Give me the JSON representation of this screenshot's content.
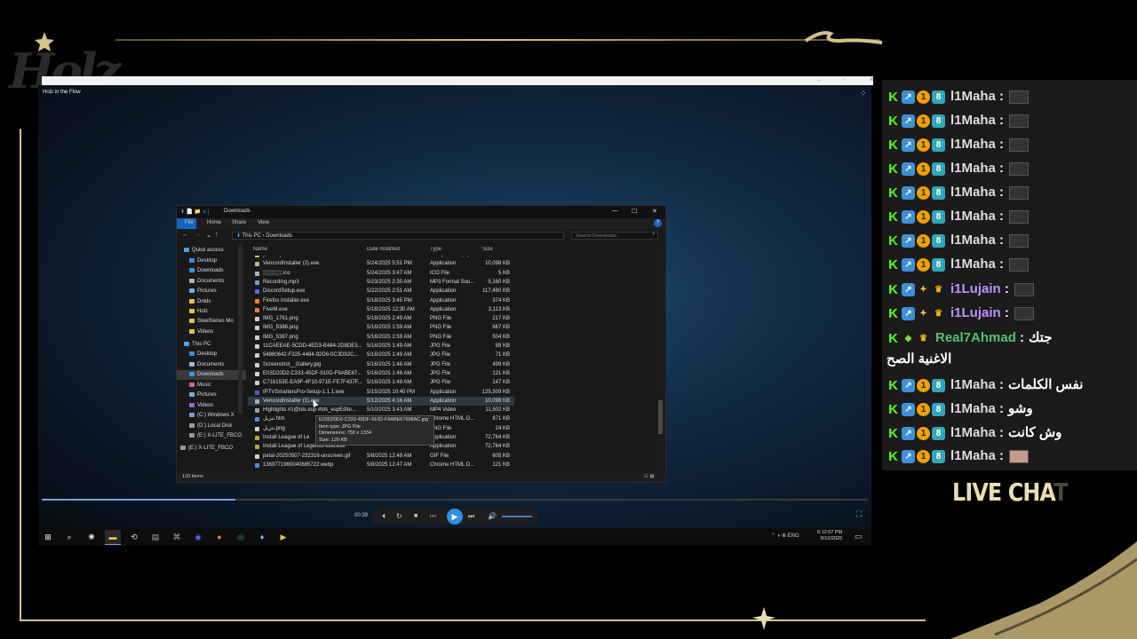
{
  "overlay": {
    "logo_text": "Holz",
    "live_chat_a": "LIVE CHA",
    "live_chat_b": "T"
  },
  "video": {
    "window_title": "Holz in the Flow",
    "window_controls": "– ▫ ✕",
    "grid_glyph": "⁘"
  },
  "explorer": {
    "title": "Downloads",
    "title_icons": "⬇ 📄 📁 ∨ |",
    "controls": {
      "min": "—",
      "max": "☐",
      "close": "✕"
    },
    "ribbon_tabs": [
      "File",
      "Home",
      "Share",
      "View"
    ],
    "address": {
      "pc": "This PC",
      "sep": "›",
      "folder": "Downloads"
    },
    "nav_arrows": [
      "←",
      "→",
      "⌄",
      "↑"
    ],
    "search_placeholder": "Search Downloads",
    "columns": {
      "name": "Name",
      "date": "Date modified",
      "type": "Type",
      "size": "Size"
    },
    "nav": [
      {
        "label": "Quick access",
        "color": "#4aa3f0"
      },
      {
        "label": "Desktop",
        "color": "#3a8ee0"
      },
      {
        "label": "Downloads",
        "color": "#2a9ae8"
      },
      {
        "label": "Documents",
        "color": "#9fb8d0"
      },
      {
        "label": "Pictures",
        "color": "#6ab0e8"
      },
      {
        "label": "Dnlds",
        "color": "#e8c04a"
      },
      {
        "label": "Holz",
        "color": "#e8c04a"
      },
      {
        "label": "SteelSeries Mo",
        "color": "#e8c04a"
      },
      {
        "label": "Videos",
        "color": "#e8c04a"
      },
      {
        "label": "This PC",
        "color": "#4aa3f0"
      },
      {
        "label": "Desktop",
        "color": "#3a8ee0"
      },
      {
        "label": "Documents",
        "color": "#9fb8d0"
      },
      {
        "label": "Downloads",
        "color": "#2a9ae8"
      },
      {
        "label": "Music",
        "color": "#e06080"
      },
      {
        "label": "Pictures",
        "color": "#6ab0e8"
      },
      {
        "label": "Videos",
        "color": "#a060e0"
      },
      {
        "label": "(C:) Windows X",
        "color": "#7aa0c0"
      },
      {
        "label": "(D:) Local Disk",
        "color": "#9a9a9a"
      },
      {
        "label": "(E:) X-LITE_FBCO",
        "color": "#9a9a9a"
      },
      {
        "label": "(E:) X-LITE_FBCO",
        "color": "#9a9a9a"
      }
    ],
    "files": [
      {
        "name": "yeez.zip",
        "date": "5/21/2025 2:19 AM",
        "type": "Compressed (zip...",
        "size": "2,882 KB",
        "color": "#e8c04a"
      },
      {
        "name": "VencordInstaller (2).exe",
        "date": "5/24/2025 5:51 PM",
        "type": "Application",
        "size": "10,098 KB",
        "color": "#b0b0b0"
      },
      {
        "name": "░░░░░.ico",
        "date": "5/24/2025 3:47 AM",
        "type": "ICO File",
        "size": "5 KB",
        "color": "#b0b0b0"
      },
      {
        "name": "Recording.mp3",
        "date": "5/23/2025 2:30 AM",
        "type": "MP3 Format Sou...",
        "size": "5,160 KB",
        "color": "#6aa0e0"
      },
      {
        "name": "DiscordSetup.exe",
        "date": "5/22/2025 2:51 AM",
        "type": "Application",
        "size": "117,480 KB",
        "color": "#5865f2"
      },
      {
        "name": "Firefox Installer.exe",
        "date": "5/18/2025 3:45 PM",
        "type": "Application",
        "size": "374 KB",
        "color": "#ff7b2a"
      },
      {
        "name": "FiveM.exe",
        "date": "5/18/2025 12:30 AM",
        "type": "Application",
        "size": "3,113 KB",
        "color": "#f08030"
      },
      {
        "name": "IMG_1761.png",
        "date": "5/18/2025 2:49 AM",
        "type": "PNG File",
        "size": "217 KB",
        "color": "#d0d0d0"
      },
      {
        "name": "IMG_5386.png",
        "date": "5/16/2025 1:59 AM",
        "type": "PNG File",
        "size": "667 KB",
        "color": "#d0d0d0"
      },
      {
        "name": "IMG_5387.png",
        "date": "5/16/2025 1:59 AM",
        "type": "PNG File",
        "size": "504 KB",
        "color": "#d0d0d0"
      },
      {
        "name": "11CAEEAE-5CDD-4ED3-B484-2D8DE3...",
        "date": "5/16/2025 1:49 AM",
        "type": "JPG File",
        "size": "89 KB",
        "color": "#d0d0d0"
      },
      {
        "name": "54860642-F325-4484-92D6-0C3D92C...",
        "date": "5/16/2025 1:49 AM",
        "type": "JPG File",
        "size": "71 KB",
        "color": "#d0d0d0"
      },
      {
        "name": "Screenshot__Gallery.jpg",
        "date": "5/16/2025 1:48 AM",
        "type": "JPG File",
        "size": "499 KB",
        "color": "#d0d0d0"
      },
      {
        "name": "E03D20D2-C333-45DF-910D-F9ABE67...",
        "date": "5/16/2025 1:48 AM",
        "type": "JPG File",
        "size": "121 KB",
        "color": "#d0d0d0"
      },
      {
        "name": "C716153E-EA9F-4F10-971E-FE7F437F...",
        "date": "5/16/2025 1:48 AM",
        "type": "JPG File",
        "size": "147 KB",
        "color": "#d0d0d0"
      },
      {
        "name": "IPTVSmartersPro-Setup-1.1.1.exe",
        "date": "5/15/2025 10:40 PM",
        "type": "Application",
        "size": "125,509 KB",
        "color": "#6050e0"
      },
      {
        "name": "VencordInstaller (1).exe",
        "date": "5/12/2025 4:16 AM",
        "type": "Application",
        "size": "10,098 KB",
        "color": "#b0b0b0"
      },
      {
        "name": "Highlights #1@tds.esp #tds_espEdite...",
        "date": "5/10/2025 3:43 AM",
        "type": "MP4 Video",
        "size": "11,502 KB",
        "color": "#a0a0a0"
      },
      {
        "name": "تنزيل.htm",
        "date": "",
        "type": "Chrome HTML D...",
        "size": "871 KB",
        "color": "#4a90e0"
      },
      {
        "name": "تنزيل.png",
        "date": "",
        "type": "PNG File",
        "size": "24 KB",
        "color": "#d0d0d0"
      },
      {
        "name": "Install League of Le",
        "date": "",
        "type": "Application",
        "size": "72,764 KB",
        "color": "#c0a040"
      },
      {
        "name": "Install League of Legends euw.exe",
        "date": "",
        "type": "Application",
        "size": "72,764 KB",
        "color": "#c0a040"
      },
      {
        "name": "petal-20250507-232316-unscreen.gif",
        "date": "5/8/2025 12:49 AM",
        "type": "GIF File",
        "size": "605 KB",
        "color": "#d0d0d0"
      },
      {
        "name": "1369771960040685722.webp",
        "date": "5/8/2025 12:47 AM",
        "type": "Chrome HTML D...",
        "size": "121 KB",
        "color": "#4a90e0"
      }
    ],
    "tooltip": {
      "l1": "E03D20D2-C333-45DF-910D-F9ABE67698AC.jpg",
      "l2": "Item type: JPG File",
      "l3": "Dimensions: 750 x 1334",
      "l4": "Size: 120 KB"
    },
    "status": "120 items",
    "view_icons": "☷ ▦"
  },
  "player": {
    "elapsed": "00:39",
    "progress_fraction": 0.234,
    "buttons": {
      "slow": "⏴",
      "loop": "↻",
      "stop": "■",
      "prev": "⏮",
      "play": "▶",
      "next": "⏭",
      "volume": "🔊"
    },
    "fullscreen_glyph": "⛶"
  },
  "taskbar": {
    "icons": [
      {
        "glyph": "⊞",
        "name": "windows-start-icon",
        "color": "#ffffff"
      },
      {
        "glyph": "⌕",
        "name": "search-icon",
        "color": "#ffffff"
      },
      {
        "glyph": "✺",
        "name": "settings-icon",
        "color": "#dddddd"
      },
      {
        "glyph": "▬",
        "name": "file-explorer-icon",
        "color": "#e8c04a"
      },
      {
        "glyph": "⟲",
        "name": "back-app-icon",
        "color": "#dddddd"
      },
      {
        "glyph": "▤",
        "name": "app-icon",
        "color": "#aaaaaa"
      },
      {
        "glyph": "⌘",
        "name": "terminal-icon",
        "color": "#aaaaaa"
      },
      {
        "glyph": "◉",
        "name": "obs-icon",
        "color": "#5865f2"
      },
      {
        "glyph": "●",
        "name": "firefox-icon",
        "color": "#ff7b2a"
      },
      {
        "glyph": "◎",
        "name": "chrome-icon",
        "color": "#34a853"
      },
      {
        "glyph": "♦",
        "name": "steam-icon",
        "color": "#66c0f4"
      },
      {
        "glyph": "▶",
        "name": "media-player-icon",
        "color": "#e8c04a"
      }
    ],
    "tray": "⌃  ◖  ⊕  ENG",
    "time": "6:12:07 PM",
    "date": "9/10/2025",
    "notify_glyph": "▭"
  },
  "chat": {
    "messages": [
      {
        "user": "l1Maha",
        "sep": " :",
        "text": "",
        "badges": [
          "k",
          "arrow",
          "one",
          "sub"
        ],
        "emote": true,
        "ucls": ""
      },
      {
        "user": "l1Maha",
        "sep": " :",
        "text": "",
        "badges": [
          "k",
          "arrow",
          "one",
          "sub"
        ],
        "emote": true,
        "ucls": ""
      },
      {
        "user": "l1Maha",
        "sep": " :",
        "text": "",
        "badges": [
          "k",
          "arrow",
          "one",
          "sub"
        ],
        "emote": true,
        "ucls": ""
      },
      {
        "user": "l1Maha",
        "sep": " :",
        "text": "",
        "badges": [
          "k",
          "arrow",
          "one",
          "sub"
        ],
        "emote": true,
        "ucls": ""
      },
      {
        "user": "l1Maha",
        "sep": " :",
        "text": "",
        "badges": [
          "k",
          "arrow",
          "one",
          "sub"
        ],
        "emote": true,
        "ucls": ""
      },
      {
        "user": "l1Maha",
        "sep": " :",
        "text": "",
        "badges": [
          "k",
          "arrow",
          "one",
          "sub"
        ],
        "emote": true,
        "ucls": ""
      },
      {
        "user": "l1Maha",
        "sep": " :",
        "text": "",
        "badges": [
          "k",
          "arrow",
          "one",
          "sub"
        ],
        "emote": true,
        "ucls": ""
      },
      {
        "user": "l1Maha",
        "sep": " :",
        "text": "",
        "badges": [
          "k",
          "arrow",
          "one",
          "sub"
        ],
        "emote": true,
        "ucls": ""
      },
      {
        "user": "i1Lujain",
        "sep": " :",
        "text": "",
        "badges": [
          "k",
          "arrow",
          "plus",
          "crown"
        ],
        "emote": true,
        "ucls": "purple"
      },
      {
        "user": "i1Lujain",
        "sep": " :",
        "text": "",
        "badges": [
          "k",
          "arrow",
          "plus",
          "crown"
        ],
        "emote": true,
        "ucls": "purple"
      },
      {
        "user": "Real7Ahmad",
        "sep": " :",
        "text": "جتك",
        "badges": [
          "k",
          "diamond",
          "crown"
        ],
        "emote": false,
        "ucls": "green"
      },
      {
        "user": "",
        "sep": "",
        "text": "الاغنية الصح",
        "badges": [],
        "emote": false,
        "ucls": ""
      },
      {
        "user": "l1Maha",
        "sep": " :",
        "text": "نفس الكلمات",
        "badges": [
          "k",
          "arrow",
          "one",
          "sub"
        ],
        "emote": false,
        "ucls": ""
      },
      {
        "user": "l1Maha",
        "sep": " :",
        "text": "وشو",
        "badges": [
          "k",
          "arrow",
          "one",
          "sub"
        ],
        "emote": false,
        "ucls": ""
      },
      {
        "user": "l1Maha",
        "sep": " :",
        "text": "وش كانت",
        "badges": [
          "k",
          "arrow",
          "one",
          "sub"
        ],
        "emote": false,
        "ucls": ""
      },
      {
        "user": "l1Maha",
        "sep": " :",
        "text": "",
        "badges": [
          "k",
          "arrow",
          "one",
          "sub"
        ],
        "emote": "face",
        "ucls": ""
      }
    ],
    "badge_glyphs": {
      "k": "K",
      "arrow": "↗",
      "one": "1",
      "sub": "8",
      "plus": "✦",
      "crown": "♛",
      "diamond": "◆"
    }
  },
  "colors": {
    "gold": "#d6c28a",
    "accent_blue": "#2e8ee6",
    "kick_green": "#53fc18"
  }
}
